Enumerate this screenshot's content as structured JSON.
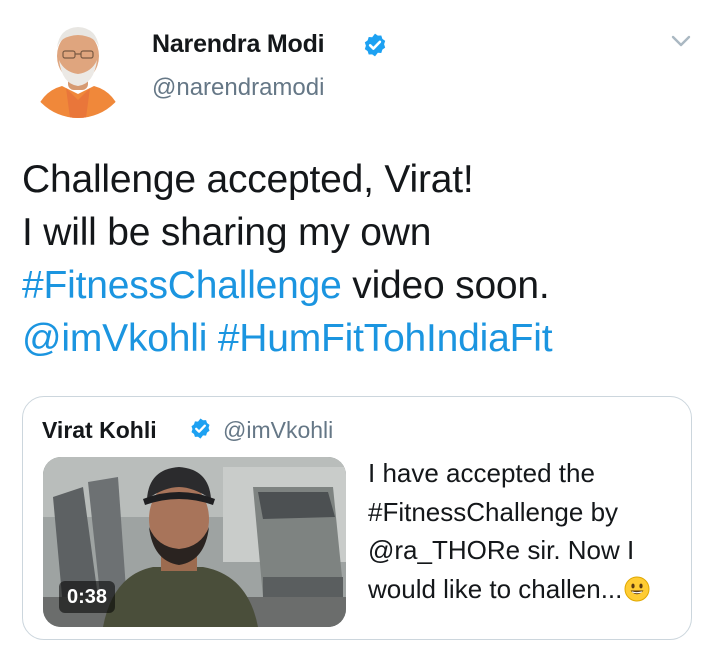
{
  "tweet": {
    "author": {
      "name": "Narendra Modi",
      "handle": "@narendramodi",
      "verified": true,
      "avatar_icon": "profile-photo-avatar"
    },
    "menu_icon": "chevron-down-icon",
    "text": {
      "line1": "Challenge accepted, Virat!",
      "line2": "I will be sharing my own",
      "line3_hashtag": "#FitnessChallenge",
      "line3_rest": " video soon.",
      "line4_mention": "@imVkohli",
      "line4_space": " ",
      "line4_hashtag": "#HumFitTohIndiaFit"
    },
    "link_color": "#1b95e0"
  },
  "quoted_tweet": {
    "author": {
      "name": "Virat Kohli",
      "handle": "@imVkohli",
      "verified": true
    },
    "video": {
      "duration": "0:38",
      "thumbnail_icon": "video-thumbnail"
    },
    "text": {
      "line1": "I have accepted the",
      "line2": "#FitnessChallenge by",
      "line3": "@ra_THORe sir. Now I",
      "line4": "would like to challen...",
      "emoji": "grinning-face-emoji"
    }
  },
  "colors": {
    "verified_badge": "#1da1f2",
    "secondary_text": "#657786",
    "border": "#ccd6dd"
  }
}
